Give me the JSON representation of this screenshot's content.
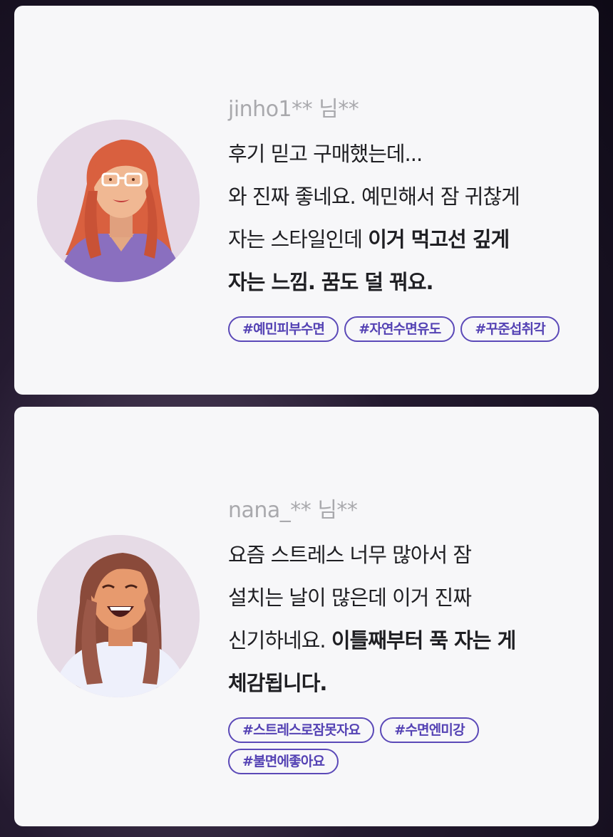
{
  "reviews": [
    {
      "user": "jinho1** 님**",
      "lines": [
        {
          "normal": "후기 믿고 구매했는데...",
          "bold": ""
        },
        {
          "normal": "와 진짜 좋네요. 예민해서 잠 귀찮게",
          "bold": ""
        },
        {
          "normal": "자는 스타일인데 ",
          "bold": "이거 먹고선 깊게"
        },
        {
          "normal": "",
          "bold": "자는 느낌. 꿈도 덜 꿔요."
        }
      ],
      "tags": [
        "#예민피부수면",
        "#자연수면유도",
        "#꾸준섭취각"
      ]
    },
    {
      "user": "nana_** 님**",
      "lines": [
        {
          "normal": "요즘 스트레스 너무 많아서 잠",
          "bold": ""
        },
        {
          "normal": "설치는 날이 많은데 이거 진짜",
          "bold": ""
        },
        {
          "normal": "신기하네요. ",
          "bold": "이틀째부터 푹 자는 게"
        },
        {
          "normal": "",
          "bold": "체감됩니다."
        }
      ],
      "tags": [
        "#스트레스로잠못자요",
        "#수면엔미강",
        "#불면에좋아요"
      ]
    }
  ],
  "colors": {
    "tag_border": "#5b49b8",
    "tag_text": "#5442b4",
    "card_bg": "#f7f7f9",
    "username": "#a9a9ad"
  }
}
